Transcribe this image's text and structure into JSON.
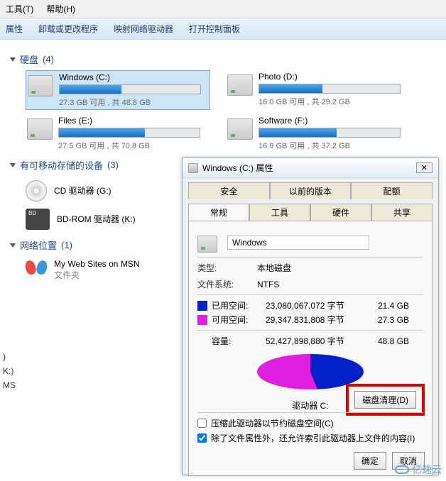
{
  "menu": {
    "tools": "工具(T)",
    "help": "帮助(H)"
  },
  "toolbar": {
    "properties": "属性",
    "uninstall": "卸载或更改程序",
    "map": "映射网络驱动器",
    "control": "打开控制面板"
  },
  "sections": {
    "drives": {
      "label": "硬盘",
      "count": "(4)"
    },
    "removable": {
      "label": "有可移动存储的设备",
      "count": "(3)"
    },
    "network": {
      "label": "网络位置",
      "count": "(1)"
    }
  },
  "drives": [
    {
      "name": "Windows (C:)",
      "text": "27.3 GB 可用 , 共 48.8 GB",
      "fill": 44
    },
    {
      "name": "Photo (D:)",
      "text": "16.0 GB 可用 , 共 29.2 GB",
      "fill": 45
    },
    {
      "name": "Files (E:)",
      "text": "27.5 GB 可用 , 共 70.8 GB",
      "fill": 61
    },
    {
      "name": "Software (F:)",
      "text": "16.9 GB 可用 , 共 37.2 GB",
      "fill": 55
    }
  ],
  "removable": [
    {
      "name": "CD 驱动器 (G:)"
    },
    {
      "name": "BD-ROM 驱动器 (K:)"
    }
  ],
  "network_item": {
    "name": "My Web Sites on MSN",
    "sub": "文件夹"
  },
  "dialog": {
    "title": "Windows (C:) 属性",
    "tabs": {
      "security": "安全",
      "prev": "以前的版本",
      "quota": "配额",
      "general": "常规",
      "tools": "工具",
      "hardware": "硬件",
      "sharing": "共享"
    },
    "namebox": "Windows",
    "type_label": "类型:",
    "type_value": "本地磁盘",
    "fs_label": "文件系统:",
    "fs_value": "NTFS",
    "used_label": "已用空间:",
    "used_bytes": "23,080,067,072 字节",
    "used_gb": "21.4 GB",
    "free_label": "可用空间:",
    "free_bytes": "29,347,831,808 字节",
    "free_gb": "27.3 GB",
    "cap_label": "容量:",
    "cap_bytes": "52,427,898,880 字节",
    "cap_gb": "48.8 GB",
    "drive_line": "驱动器 C:",
    "cleanup_btn": "磁盘清理(D)",
    "compress": "压缩此驱动器以节约磁盘空间(C)",
    "indexing": "除了文件属性外，还允许索引此驱动器上文件的内容(I)",
    "ok": "确定",
    "cancel": "取消"
  },
  "sidebar_left": {
    "a": ")",
    "b": "K:)",
    "c": "MS"
  },
  "watermark": "亿速云",
  "chart_data": {
    "type": "pie",
    "title": "驱动器 C:",
    "series": [
      {
        "name": "已用空间",
        "value": 21.4,
        "bytes": 23080067072,
        "color": "#0020c8"
      },
      {
        "name": "可用空间",
        "value": 27.3,
        "bytes": 29347831808,
        "color": "#e020e0"
      }
    ],
    "total": {
      "name": "容量",
      "value": 48.8,
      "bytes": 52427898880
    },
    "unit": "GB"
  }
}
